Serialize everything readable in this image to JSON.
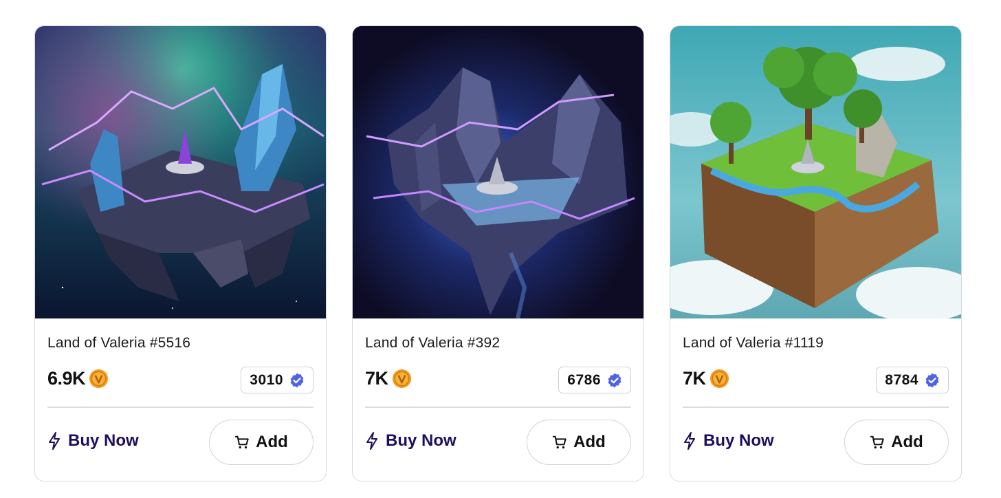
{
  "cards": [
    {
      "title": "Land of Valeria #5516",
      "price": "6.9K",
      "count": "3010",
      "buy_label": "Buy Now",
      "add_label": "Add",
      "image": "aurora-crystal-island"
    },
    {
      "title": "Land of Valeria #392",
      "price": "7K",
      "count": "6786",
      "buy_label": "Buy Now",
      "add_label": "Add",
      "image": "storm-rock-island"
    },
    {
      "title": "Land of Valeria #1119",
      "price": "7K",
      "count": "8784",
      "buy_label": "Buy Now",
      "add_label": "Add",
      "image": "forest-sky-island"
    }
  ],
  "colors": {
    "accent": "#1e0f5c",
    "verified": "#4f63e8",
    "coin": "#f29a1a",
    "border": "#d3dbdf"
  }
}
